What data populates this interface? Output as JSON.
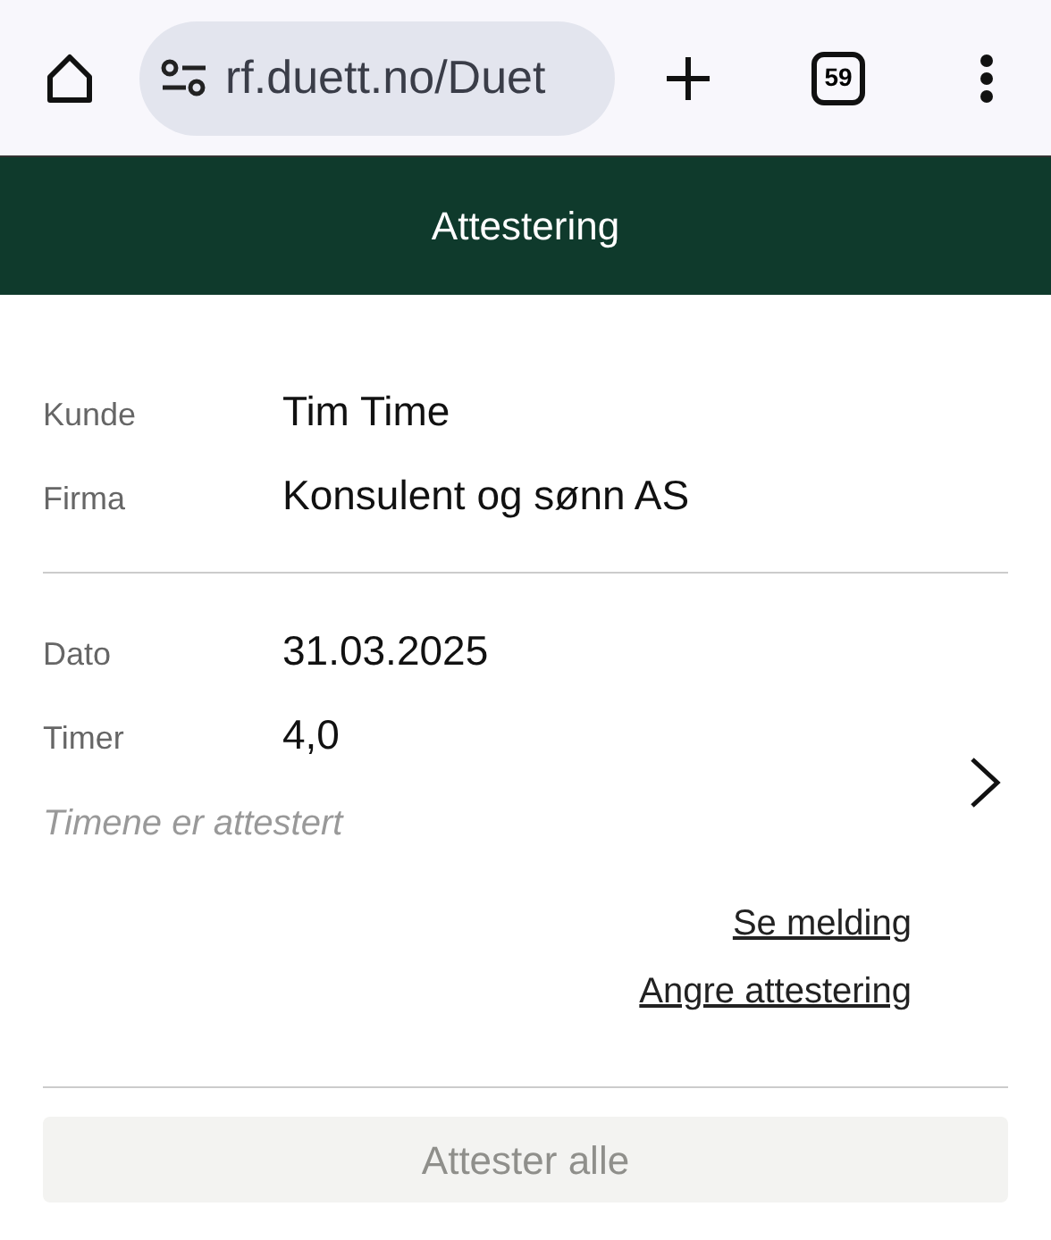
{
  "browser": {
    "url": "rf.duett.no/Duet",
    "tab_count": "59"
  },
  "header": {
    "title": "Attestering"
  },
  "customer": [
    {
      "label": "Kunde",
      "value": "Tim Time"
    },
    {
      "label": "Firma",
      "value": "Konsulent og sønn AS"
    }
  ],
  "entry": {
    "fields": [
      {
        "label": "Dato",
        "value": "31.03.2025"
      },
      {
        "label": "Timer",
        "value": "4,0"
      }
    ],
    "status": "Timene er attestert",
    "links": [
      "Se melding",
      "Angre attestering"
    ]
  },
  "approve_all": {
    "label": "Attester alle",
    "disabled": true
  }
}
